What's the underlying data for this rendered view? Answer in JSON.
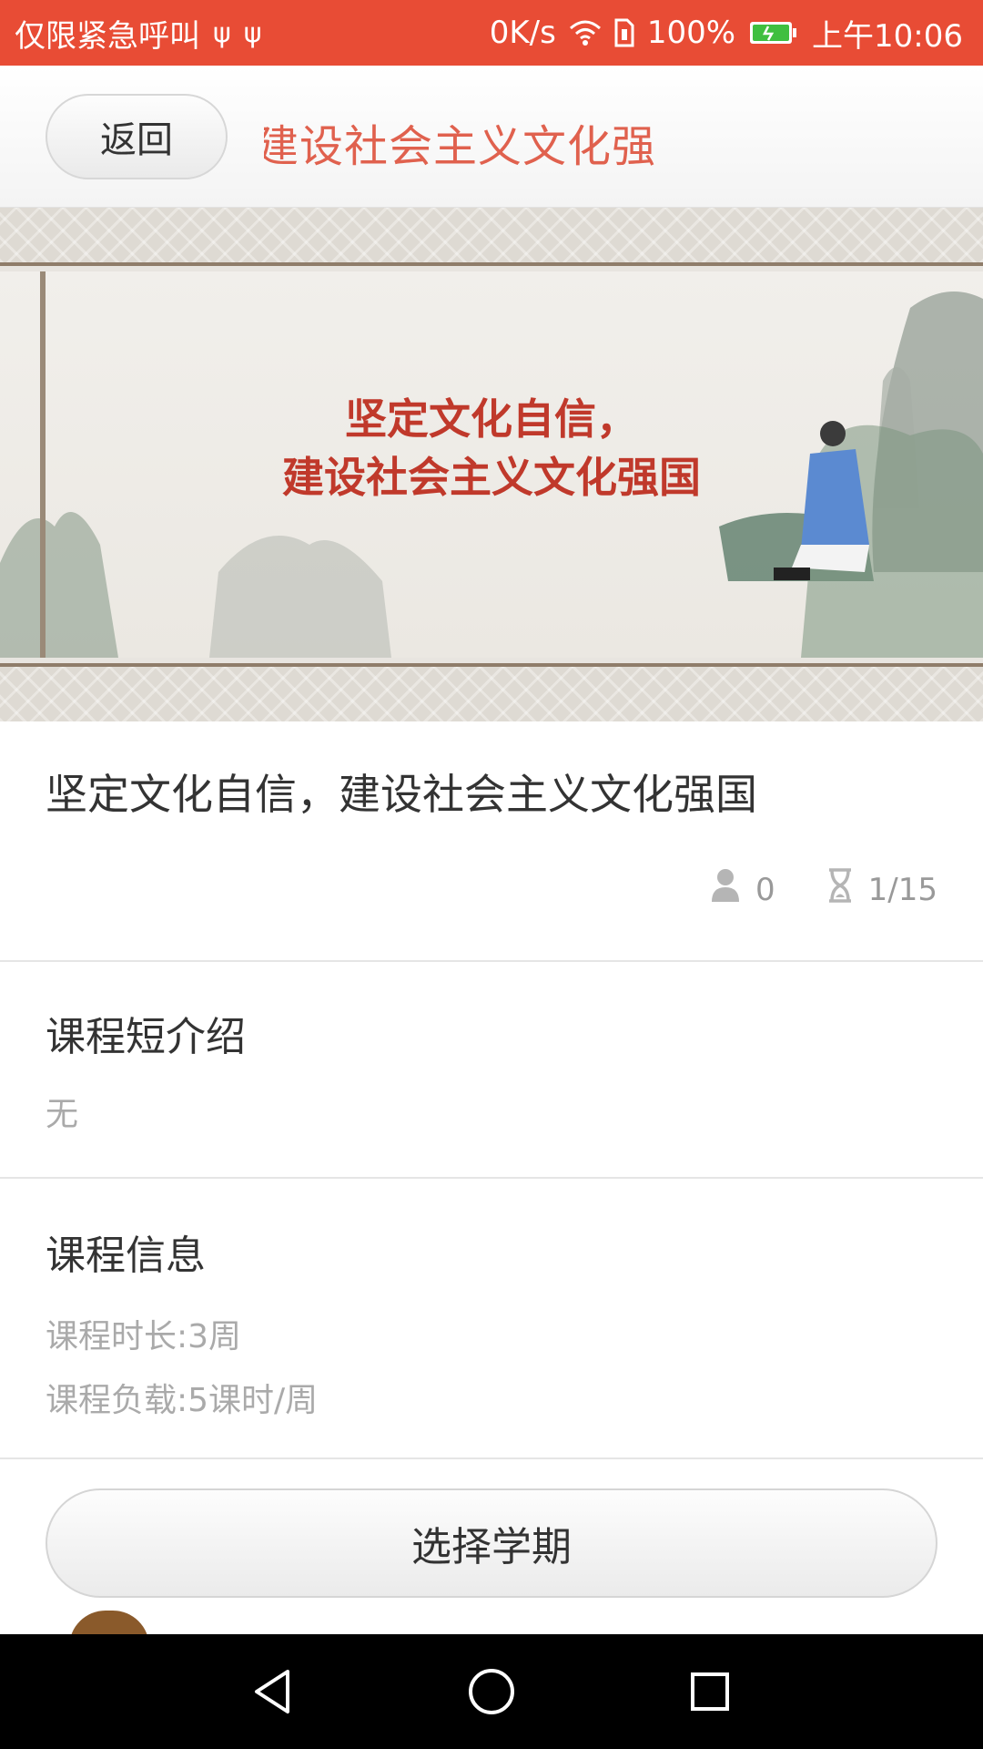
{
  "status_bar": {
    "left_text": "仅限紧急呼叫",
    "usb_icons": [
      "ψ",
      "ψ"
    ],
    "net_speed": "0K/s",
    "battery_percent": "100%",
    "time": "上午10:06",
    "bg_color": "#e84c35"
  },
  "nav": {
    "back_label": "返回",
    "title": "建设社会主义文化强"
  },
  "banner": {
    "line1": "坚定文化自信，",
    "line2": "建设社会主义文化强国"
  },
  "course": {
    "title": "坚定文化自信，建设社会主义文化强国",
    "learners": "0",
    "progress": "1/15"
  },
  "intro": {
    "heading": "课程短介绍",
    "text": "无"
  },
  "info": {
    "heading": "课程信息",
    "duration": "课程时长:3周",
    "load": "课程负载:5课时/周"
  },
  "actions": {
    "select_term": "选择学期"
  },
  "icons": {
    "usb": "usb-icon",
    "wifi": "wifi-icon",
    "sim": "sim-icon",
    "battery": "battery-icon",
    "person": "person-icon",
    "hourglass": "hourglass-icon",
    "back_triangle": "back-triangle-icon",
    "home_circle": "home-circle-icon",
    "recents_square": "recents-square-icon"
  }
}
